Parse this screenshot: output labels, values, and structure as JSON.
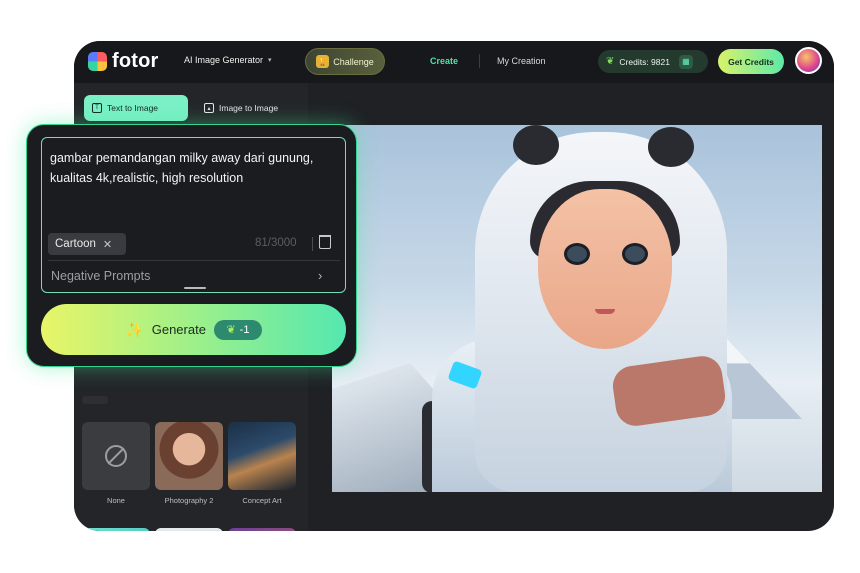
{
  "app": {
    "logo_text": "fotor"
  },
  "nav": {
    "ai_image_generator": "AI Image Generator",
    "challenge": "Challenge",
    "create": "Create",
    "my_creation": "My Creation",
    "credits": "Credits: 9821",
    "get_credits": "Get Credits"
  },
  "sidebar": {
    "tabs": [
      {
        "label": "Text to Image",
        "active": true
      },
      {
        "label": "Image to Image",
        "active": false
      }
    ],
    "styles": [
      {
        "label": "None"
      },
      {
        "label": "Photography 2"
      },
      {
        "label": "Concept Art"
      }
    ]
  },
  "prompt": {
    "text": "gambar pemandangan milky away dari gunung, kualitas 4k,realistic, high resolution",
    "tag": "Cartoon",
    "counter": "81/3000",
    "negative_label": "Negative Prompts"
  },
  "generate": {
    "label": "Generate",
    "cost": "-1"
  },
  "colors": {
    "accent": "#4fe3a6",
    "active_tab": "#7bf0c6",
    "background": "#1f2124"
  },
  "icons": [
    "logo-icon",
    "chevron-down-icon",
    "trophy-icon",
    "leaf-icon",
    "gift-icon",
    "text-icon",
    "image-icon",
    "close-icon",
    "trash-icon",
    "chevron-right-icon",
    "magic-wand-icon",
    "none-icon"
  ]
}
